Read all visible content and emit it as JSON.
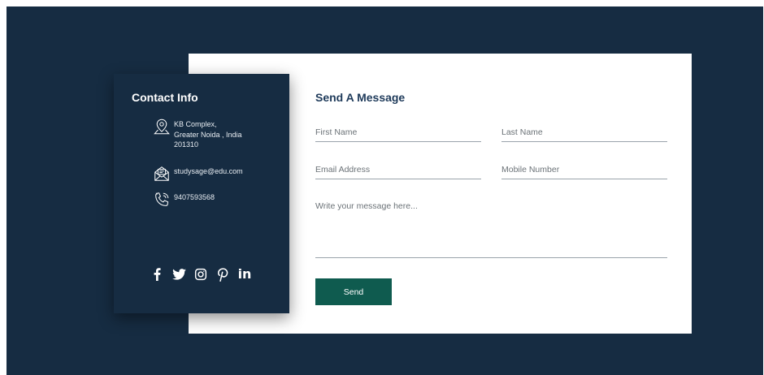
{
  "colors": {
    "page_background": "#162c42",
    "card_background": "#ffffff",
    "accent_button": "#0f5b4f",
    "form_title": "#1e3a5a"
  },
  "contact_info": {
    "title": "Contact Info",
    "address": {
      "icon": "location-pin-icon",
      "text": "KB Complex,\nGreater Noida , India\n201310"
    },
    "email": {
      "icon": "mail-icon",
      "text": "studysage@edu.com"
    },
    "phone": {
      "icon": "phone-icon",
      "text": "9407593568"
    },
    "socials": [
      {
        "name": "facebook",
        "icon": "facebook-icon"
      },
      {
        "name": "twitter",
        "icon": "twitter-icon"
      },
      {
        "name": "instagram",
        "icon": "instagram-icon"
      },
      {
        "name": "pinterest",
        "icon": "pinterest-icon"
      },
      {
        "name": "linkedin",
        "icon": "linkedin-icon",
        "text": "in"
      }
    ]
  },
  "form": {
    "title": "Send A Message",
    "first_name_placeholder": "First Name",
    "last_name_placeholder": "Last Name",
    "email_placeholder": "Email Address",
    "mobile_placeholder": "Mobile Number",
    "message_placeholder": "Write your message here...",
    "send_label": "Send"
  }
}
